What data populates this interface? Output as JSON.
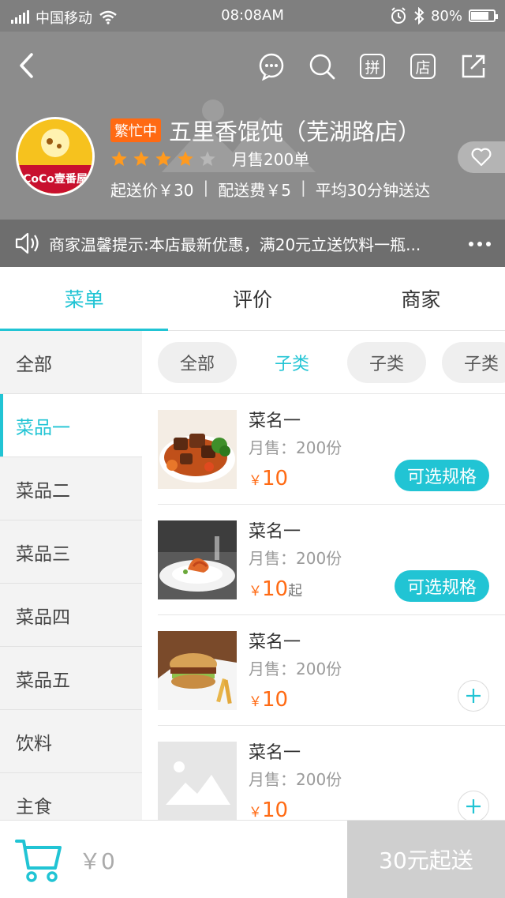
{
  "status_bar": {
    "carrier": "中国移动",
    "time": "08:08AM",
    "battery": "80%",
    "battery_level": 0.8
  },
  "shop": {
    "busy_badge": "繁忙中",
    "name": "五里香馄饨（芜湖路店）",
    "rating_stars": 4,
    "rating_max": 5,
    "monthly_sales": "月售200单",
    "min_order": "起送价￥30",
    "delivery_fee": "配送费￥5",
    "avg_time": "平均30分钟送达",
    "logo_text": "CoCo壹番屋"
  },
  "notice": {
    "text": "商家温馨提示:本店最新优惠，满20元立送饮料一瓶..."
  },
  "tabs": [
    {
      "label": "菜单",
      "active": true
    },
    {
      "label": "评价",
      "active": false
    },
    {
      "label": "商家",
      "active": false
    }
  ],
  "categories": [
    {
      "label": "全部",
      "active": false
    },
    {
      "label": "菜品一",
      "active": true
    },
    {
      "label": "菜品二",
      "active": false
    },
    {
      "label": "菜品三",
      "active": false
    },
    {
      "label": "菜品四",
      "active": false
    },
    {
      "label": "菜品五",
      "active": false
    },
    {
      "label": "饮料",
      "active": false
    },
    {
      "label": "主食",
      "active": false
    }
  ],
  "chips": [
    {
      "label": "全部",
      "active": false
    },
    {
      "label": "子类",
      "active": true
    },
    {
      "label": "子类",
      "active": false
    },
    {
      "label": "子类",
      "active": false
    }
  ],
  "dishes": [
    {
      "name": "菜名一",
      "sales": "月售：200份",
      "currency": "￥",
      "price": "10",
      "suffix": "",
      "action": "可选规格",
      "image": "beef-stew"
    },
    {
      "name": "菜名一",
      "sales": "月售：200份",
      "currency": "￥",
      "price": "10",
      "suffix": "起",
      "action": "可选规格",
      "image": "shrimp-plate"
    },
    {
      "name": "菜名一",
      "sales": "月售：200份",
      "currency": "￥",
      "price": "10",
      "suffix": "",
      "action": "add",
      "image": "burger"
    },
    {
      "name": "菜名一",
      "sales": "月售：200份",
      "currency": "￥",
      "price": "10",
      "suffix": "",
      "action": "add",
      "image": "placeholder"
    }
  ],
  "cart": {
    "total": "￥0",
    "checkout_label": "30元起送"
  },
  "colors": {
    "accent": "#21c4d4",
    "price": "#ff6a13",
    "star": "#ff9a1f",
    "header_bg": "#8c8c8c"
  }
}
